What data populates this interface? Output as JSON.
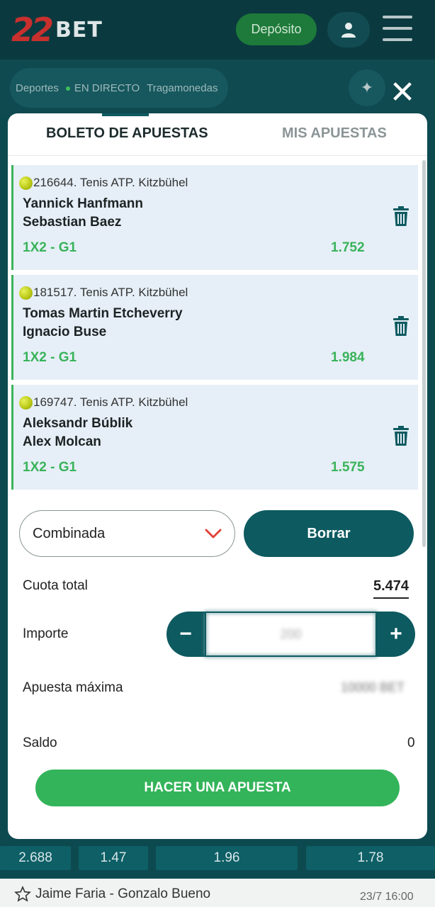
{
  "header": {
    "logo_number": "22",
    "logo_text": "BET",
    "deposit_label": "Depósito"
  },
  "nav": {
    "tabs": [
      "Deportes",
      "EN DIRECTO",
      "Tragamonedas"
    ]
  },
  "background": {
    "odds": [
      "2.688",
      "1.47",
      "1.96",
      "1.78"
    ],
    "next_match": "Jaime Faria - Gonzalo Bueno",
    "next_time": "23/7 16:00"
  },
  "betslip": {
    "tab_active": "BOLETO DE APUESTAS",
    "tab_inactive": "MIS APUESTAS",
    "bets": [
      {
        "league": "216644. Tenis ATP. Kitzbühel",
        "team1": "Yannick Hanfmann",
        "team2": "Sebastian Baez",
        "market": "1X2 - G1",
        "odd": "1.752"
      },
      {
        "league": "181517. Tenis ATP. Kitzbühel",
        "team1": "Tomas Martin Etcheverry",
        "team2": "Ignacio Buse",
        "market": "1X2 - G1",
        "odd": "1.984"
      },
      {
        "league": "169747. Tenis ATP. Kitzbühel",
        "team1": "Aleksandr Búblik",
        "team2": "Alex Molcan",
        "market": "1X2 - G1",
        "odd": "1.575"
      }
    ],
    "bet_type": "Combinada",
    "clear_label": "Borrar",
    "total_odds_label": "Cuota total",
    "total_odds": "5.474",
    "stake_label": "Importe",
    "stake_value": "200",
    "max_bet_label": "Apuesta máxima",
    "max_bet_value": "10000 BET",
    "balance_label": "Saldo",
    "balance_value": "0",
    "place_bet_label": "HACER UNA APUESTA"
  },
  "colors": {
    "brand_dark": "#0d5a60",
    "accent_green": "#34b45a",
    "card_bg": "#e6eff7"
  }
}
